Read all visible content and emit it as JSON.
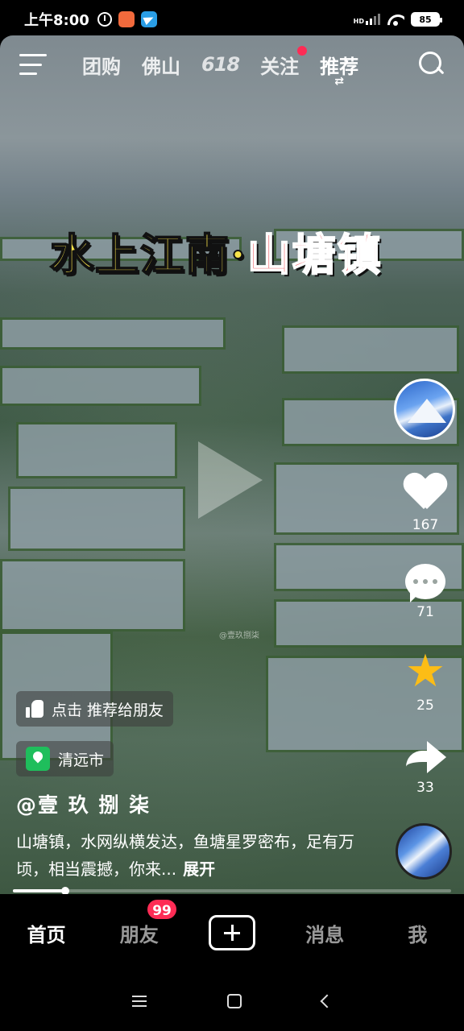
{
  "status_bar": {
    "time": "上午8:00",
    "network": "HD",
    "battery": "85"
  },
  "top_nav": {
    "tabs": [
      {
        "label": "团购"
      },
      {
        "label": "佛山"
      },
      {
        "label": "618"
      },
      {
        "label": "关注"
      },
      {
        "label": "推荐"
      }
    ],
    "refresh_glyph": "⇄"
  },
  "video": {
    "title_part1": "水上江南·",
    "title_part2": "山塘镇",
    "watermark": "@壹玖捌柒"
  },
  "actions": {
    "likes": "167",
    "comments": "71",
    "favorites": "25",
    "shares": "33"
  },
  "info": {
    "recommend_label": "点击 推荐给朋友",
    "location": "清远市",
    "author": "@壹 玖 捌 柒",
    "description": "山塘镇，水网纵横发达，鱼塘星罗密布，足有万顷，相当震撼，你来...",
    "expand_label": "展开",
    "progress": 0.12
  },
  "tab_bar": {
    "home": "首页",
    "friends": "朋友",
    "friends_badge": "99",
    "messages": "消息",
    "me": "我"
  },
  "colors": {
    "accent": "#fe2c55",
    "star": "#fcbd16",
    "location_green": "#1fbe5c",
    "title_yellow": "#f7e34a",
    "title_red": "#e8232b"
  }
}
